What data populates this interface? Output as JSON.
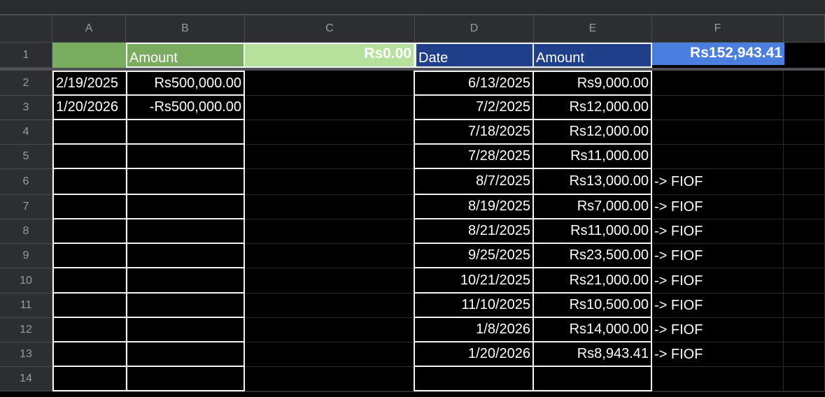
{
  "columns": [
    "A",
    "B",
    "C",
    "D",
    "E",
    "F"
  ],
  "rows": [
    "1",
    "2",
    "3",
    "4",
    "5",
    "6",
    "7",
    "8",
    "9",
    "10",
    "11",
    "12",
    "13",
    "14"
  ],
  "header": {
    "a1": "",
    "b1": "Amount",
    "c1": "Rs0.00",
    "d1": "Date",
    "e1": "Amount",
    "f1": "Rs152,943.41"
  },
  "left_table": [
    {
      "date": "2/19/2025",
      "amount": "Rs500,000.00"
    },
    {
      "date": "1/20/2026",
      "amount": "-Rs500,000.00"
    }
  ],
  "right_table": [
    {
      "date": "6/13/2025",
      "amount": "Rs9,000.00",
      "note": ""
    },
    {
      "date": "7/2/2025",
      "amount": "Rs12,000.00",
      "note": ""
    },
    {
      "date": "7/18/2025",
      "amount": "Rs12,000.00",
      "note": ""
    },
    {
      "date": "7/28/2025",
      "amount": "Rs11,000.00",
      "note": ""
    },
    {
      "date": "8/7/2025",
      "amount": "Rs13,000.00",
      "note": "-> FIOF"
    },
    {
      "date": "8/19/2025",
      "amount": "Rs7,000.00",
      "note": "-> FIOF"
    },
    {
      "date": "8/21/2025",
      "amount": "Rs11,000.00",
      "note": "-> FIOF"
    },
    {
      "date": "9/25/2025",
      "amount": "Rs23,500.00",
      "note": "-> FIOF"
    },
    {
      "date": "10/21/2025",
      "amount": "Rs21,000.00",
      "note": "-> FIOF"
    },
    {
      "date": "11/10/2025",
      "amount": "Rs10,500.00",
      "note": "-> FIOF"
    },
    {
      "date": "1/8/2026",
      "amount": "Rs14,000.00",
      "note": "-> FIOF"
    },
    {
      "date": "1/20/2026",
      "amount": "Rs8,943.41",
      "note": "-> FIOF"
    }
  ],
  "colors": {
    "green_dark": "#7aac5f",
    "green_light": "#b6e19c",
    "blue_dark": "#1f3f8a",
    "blue_bright": "#4a7fe0"
  }
}
